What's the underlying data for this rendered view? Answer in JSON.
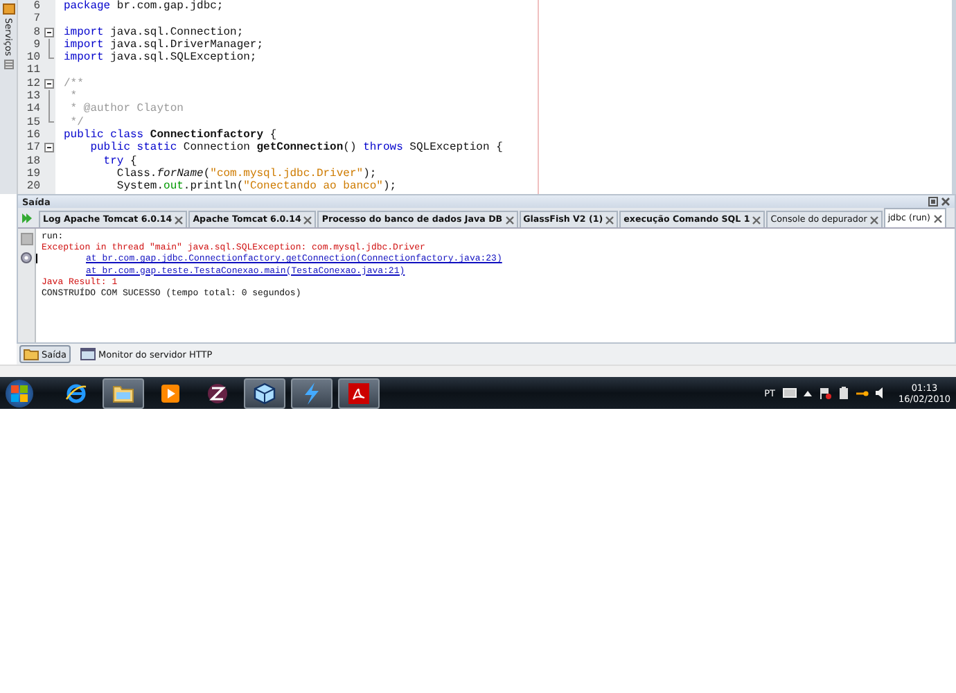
{
  "side_strip": {
    "label": "Serviços"
  },
  "editor": {
    "lines": [
      {
        "number": "6",
        "fold_toggle": false,
        "fold_line": false,
        "fold_end": false,
        "segments": [
          {
            "text": "package",
            "kind": "keyword"
          },
          {
            "text": " br.com.gap.jdbc;",
            "kind": "plain"
          }
        ]
      },
      {
        "number": "7",
        "fold_toggle": false,
        "fold_line": false,
        "fold_end": false
      },
      {
        "number": "8",
        "fold_toggle": true,
        "fold_line": false,
        "fold_end": false,
        "segments": [
          {
            "text": "import",
            "kind": "keyword"
          },
          {
            "text": " java.sql.Connection;",
            "kind": "plain"
          }
        ]
      },
      {
        "number": "9",
        "fold_toggle": false,
        "fold_line": true,
        "fold_end": false,
        "segments": [
          {
            "text": "import",
            "kind": "keyword"
          },
          {
            "text": " java.sql.DriverManager;",
            "kind": "plain"
          }
        ]
      },
      {
        "number": "10",
        "fold_toggle": false,
        "fold_line": false,
        "fold_end": true,
        "segments": [
          {
            "text": "import",
            "kind": "keyword"
          },
          {
            "text": " java.sql.SQLException;",
            "kind": "plain"
          }
        ]
      },
      {
        "number": "11",
        "fold_toggle": false,
        "fold_line": false,
        "fold_end": false
      },
      {
        "number": "12",
        "fold_toggle": true,
        "fold_line": false,
        "fold_end": false,
        "segments": [
          {
            "text": "/**",
            "kind": "comment"
          }
        ]
      },
      {
        "number": "13",
        "fold_toggle": false,
        "fold_line": true,
        "fold_end": false,
        "segments": [
          {
            "text": " *",
            "kind": "comment"
          }
        ]
      },
      {
        "number": "14",
        "fold_toggle": false,
        "fold_line": true,
        "fold_end": false,
        "segments": [
          {
            "text": " * @author Clayton",
            "kind": "comment"
          }
        ]
      },
      {
        "number": "15",
        "fold_toggle": false,
        "fold_line": false,
        "fold_end": true,
        "segments": [
          {
            "text": " */",
            "kind": "comment"
          }
        ]
      },
      {
        "number": "16",
        "fold_toggle": false,
        "fold_line": false,
        "fold_end": false,
        "segments": [
          {
            "text": "public class ",
            "kind": "keyword"
          },
          {
            "text": "Connectionfactory",
            "kind": "bold"
          },
          {
            "text": " {",
            "kind": "plain"
          }
        ]
      },
      {
        "number": "17",
        "fold_toggle": true,
        "fold_line": false,
        "fold_end": false,
        "segments": [
          {
            "text": "    public static ",
            "kind": "keyword"
          },
          {
            "text": "Connection ",
            "kind": "plain"
          },
          {
            "text": "getConnection",
            "kind": "bold"
          },
          {
            "text": "() ",
            "kind": "plain"
          },
          {
            "text": "throws",
            "kind": "keyword"
          },
          {
            "text": " SQLException {",
            "kind": "plain"
          }
        ]
      },
      {
        "number": "18",
        "fold_toggle": false,
        "fold_line": false,
        "fold_end": false,
        "segments": [
          {
            "text": "      try",
            "kind": "keyword"
          },
          {
            "text": " {",
            "kind": "plain"
          }
        ]
      },
      {
        "number": "19",
        "fold_toggle": false,
        "fold_line": false,
        "fold_end": false,
        "segments": [
          {
            "text": "        Class.",
            "kind": "plain"
          },
          {
            "text": "forName",
            "kind": "italic"
          },
          {
            "text": "(",
            "kind": "plain"
          },
          {
            "text": "\"com.mysql.jdbc.Driver\"",
            "kind": "string"
          },
          {
            "text": ");",
            "kind": "plain"
          }
        ]
      },
      {
        "number": "20",
        "fold_toggle": false,
        "fold_line": false,
        "fold_end": false,
        "segments": [
          {
            "text": "        System.",
            "kind": "plain"
          },
          {
            "text": "out",
            "kind": "field"
          },
          {
            "text": ".println(",
            "kind": "plain"
          },
          {
            "text": "\"Conectando ao banco\"",
            "kind": "string"
          },
          {
            "text": ");",
            "kind": "plain"
          }
        ]
      }
    ]
  },
  "output_panel": {
    "title": "Saída",
    "tabs": [
      {
        "label": "Log Apache Tomcat 6.0.14",
        "bold": true,
        "selected": false
      },
      {
        "label": "Apache Tomcat 6.0.14",
        "bold": true,
        "selected": false
      },
      {
        "label": "Processo do banco de dados Java DB",
        "bold": true,
        "selected": false
      },
      {
        "label": "GlassFish V2 (1)",
        "bold": true,
        "selected": false
      },
      {
        "label": "execução Comando SQL 1",
        "bold": true,
        "selected": false
      },
      {
        "label": "Console do depurador",
        "bold": false,
        "selected": false
      },
      {
        "label": "jdbc (run)",
        "bold": false,
        "selected": true
      }
    ],
    "lines": [
      {
        "text": "run:",
        "kind": "plain"
      },
      {
        "text": "Exception in thread \"main\" java.sql.SQLException: com.mysql.jdbc.Driver",
        "kind": "error"
      },
      {
        "text": "at br.com.gap.jdbc.Connectionfactory.getConnection(Connectionfactory.java:23)",
        "kind": "link"
      },
      {
        "text": "at br.com.gap.teste.TestaConexao.main(TestaConexao.java:21)",
        "kind": "link"
      },
      {
        "text": "Java Result: 1",
        "kind": "error"
      },
      {
        "text": "CONSTRUÍDO COM SUCESSO (tempo total: 0 segundos)",
        "kind": "plain"
      }
    ]
  },
  "bottom_tabs": [
    {
      "label": "Saída",
      "selected": true
    },
    {
      "label": "Monitor do servidor HTTP",
      "selected": false
    }
  ],
  "taskbar": {
    "apps": [
      {
        "kind": "browser",
        "selected": false
      },
      {
        "kind": "folder",
        "selected": true
      },
      {
        "kind": "media",
        "selected": false
      },
      {
        "kind": "z-app",
        "selected": false
      },
      {
        "kind": "cube",
        "selected": true
      },
      {
        "kind": "bolt",
        "selected": true
      },
      {
        "kind": "pdf",
        "selected": true
      }
    ],
    "language": "PT",
    "time": "01:13",
    "date": "16/02/2010"
  }
}
